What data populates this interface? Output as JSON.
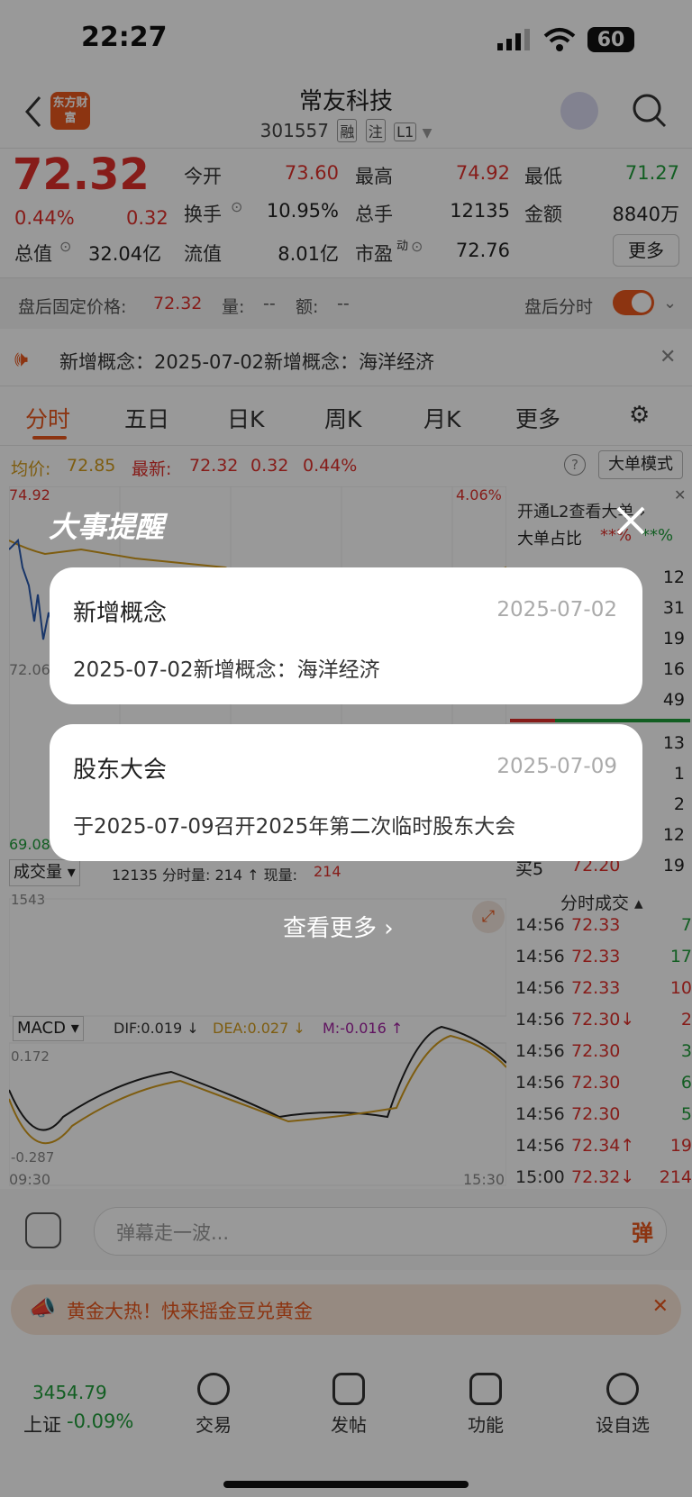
{
  "status": {
    "time": "22:27",
    "battery": "60"
  },
  "nav": {
    "title": "常友科技",
    "code": "301557",
    "tags": [
      "融",
      "注",
      "L1"
    ],
    "logo": "东方财富"
  },
  "quote": {
    "price": "72.32",
    "change_pct": "0.44%",
    "change": "0.32",
    "open_label": "今开",
    "open": "73.60",
    "high_label": "最高",
    "high": "74.92",
    "low_label": "最低",
    "low": "71.27",
    "turnover_label": "换手",
    "turnover": "10.95%",
    "volume_label": "总手",
    "volume": "12135",
    "amount_label": "金额",
    "amount": "8840万",
    "mktcap_label": "总值",
    "mktcap": "32.04亿",
    "float_label": "流值",
    "float": "8.01亿",
    "pe_label": "市盈",
    "pe_sup": "动",
    "pe": "72.76",
    "more_label": "更多"
  },
  "afterhours": {
    "label": "盘后固定价格:",
    "price": "72.32",
    "vol_label": "量:",
    "vol": "--",
    "amt_label": "额:",
    "amt": "--",
    "toggle_label": "盘后分时"
  },
  "notice": {
    "text": "新增概念：2025-07-02新增概念：海洋经济"
  },
  "tabs": [
    "分时",
    "五日",
    "日K",
    "周K",
    "月K",
    "更多"
  ],
  "avg_line": {
    "avg_label": "均价:",
    "avg": "72.85",
    "latest_label": "最新:",
    "latest": "72.32",
    "chg": "0.32",
    "pct": "0.44%",
    "mode_label": "大单模式"
  },
  "chart": {
    "top_price": "74.92",
    "top_pct": "4.06%",
    "mid_price": "72.06",
    "low_price": "69.08",
    "vol_max": "1543",
    "macd_top": "0.172",
    "macd_low": "-0.287",
    "time_start": "09:30",
    "time_end": "15:30"
  },
  "volume_bar": {
    "label": "成交量",
    "info": "12135 分时量: 214 ↑ 现量:",
    "now": "214"
  },
  "macd_bar": {
    "label": "MACD",
    "dif": "DIF:0.019 ↓",
    "dea": "DEA:0.027 ↓",
    "m": "M:-0.016 ↑"
  },
  "right_panel": {
    "l2_label": "开通L2查看大单 ›",
    "ratio_label": "大单占比",
    "ratio_red": "**%",
    "ratio_green": "**%",
    "book_top": [
      "12",
      "31",
      "19",
      "16",
      "49"
    ],
    "book_bottom": [
      "13",
      "1",
      "2",
      "12",
      "19"
    ],
    "buy5_label": "买5",
    "buy5_price": "72.20",
    "ticks_label": "分时成交",
    "ticks": [
      {
        "t": "14:56",
        "p": "72.33",
        "v": "7",
        "c": "green"
      },
      {
        "t": "14:56",
        "p": "72.33",
        "v": "17",
        "c": "green"
      },
      {
        "t": "14:56",
        "p": "72.33",
        "v": "10",
        "c": "red"
      },
      {
        "t": "14:56",
        "p": "72.30↓",
        "v": "2",
        "c": "red"
      },
      {
        "t": "14:56",
        "p": "72.30",
        "v": "3",
        "c": "green"
      },
      {
        "t": "14:56",
        "p": "72.30",
        "v": "6",
        "c": "green"
      },
      {
        "t": "14:56",
        "p": "72.30",
        "v": "5",
        "c": "green"
      },
      {
        "t": "14:56",
        "p": "72.34↑",
        "v": "19",
        "c": "red"
      },
      {
        "t": "15:00",
        "p": "72.32↓",
        "v": "214",
        "c": "red"
      }
    ]
  },
  "comment": {
    "placeholder": "弹幕走一波...",
    "send_label": "弹"
  },
  "promo": {
    "text": "黄金大热！快来摇金豆兑黄金"
  },
  "bottom": {
    "index_value": "3454.79",
    "index_name": "上证",
    "index_chg": "-0.09%",
    "items": [
      "交易",
      "发帖",
      "功能",
      "设自选"
    ]
  },
  "modal": {
    "title": "大事提醒",
    "events": [
      {
        "title": "新增概念",
        "date": "2025-07-02",
        "body": "2025-07-02新增概念：海洋经济"
      },
      {
        "title": "股东大会",
        "date": "2025-07-09",
        "body": "于2025-07-09召开2025年第二次临时股东大会"
      }
    ],
    "more_label": "查看更多"
  }
}
